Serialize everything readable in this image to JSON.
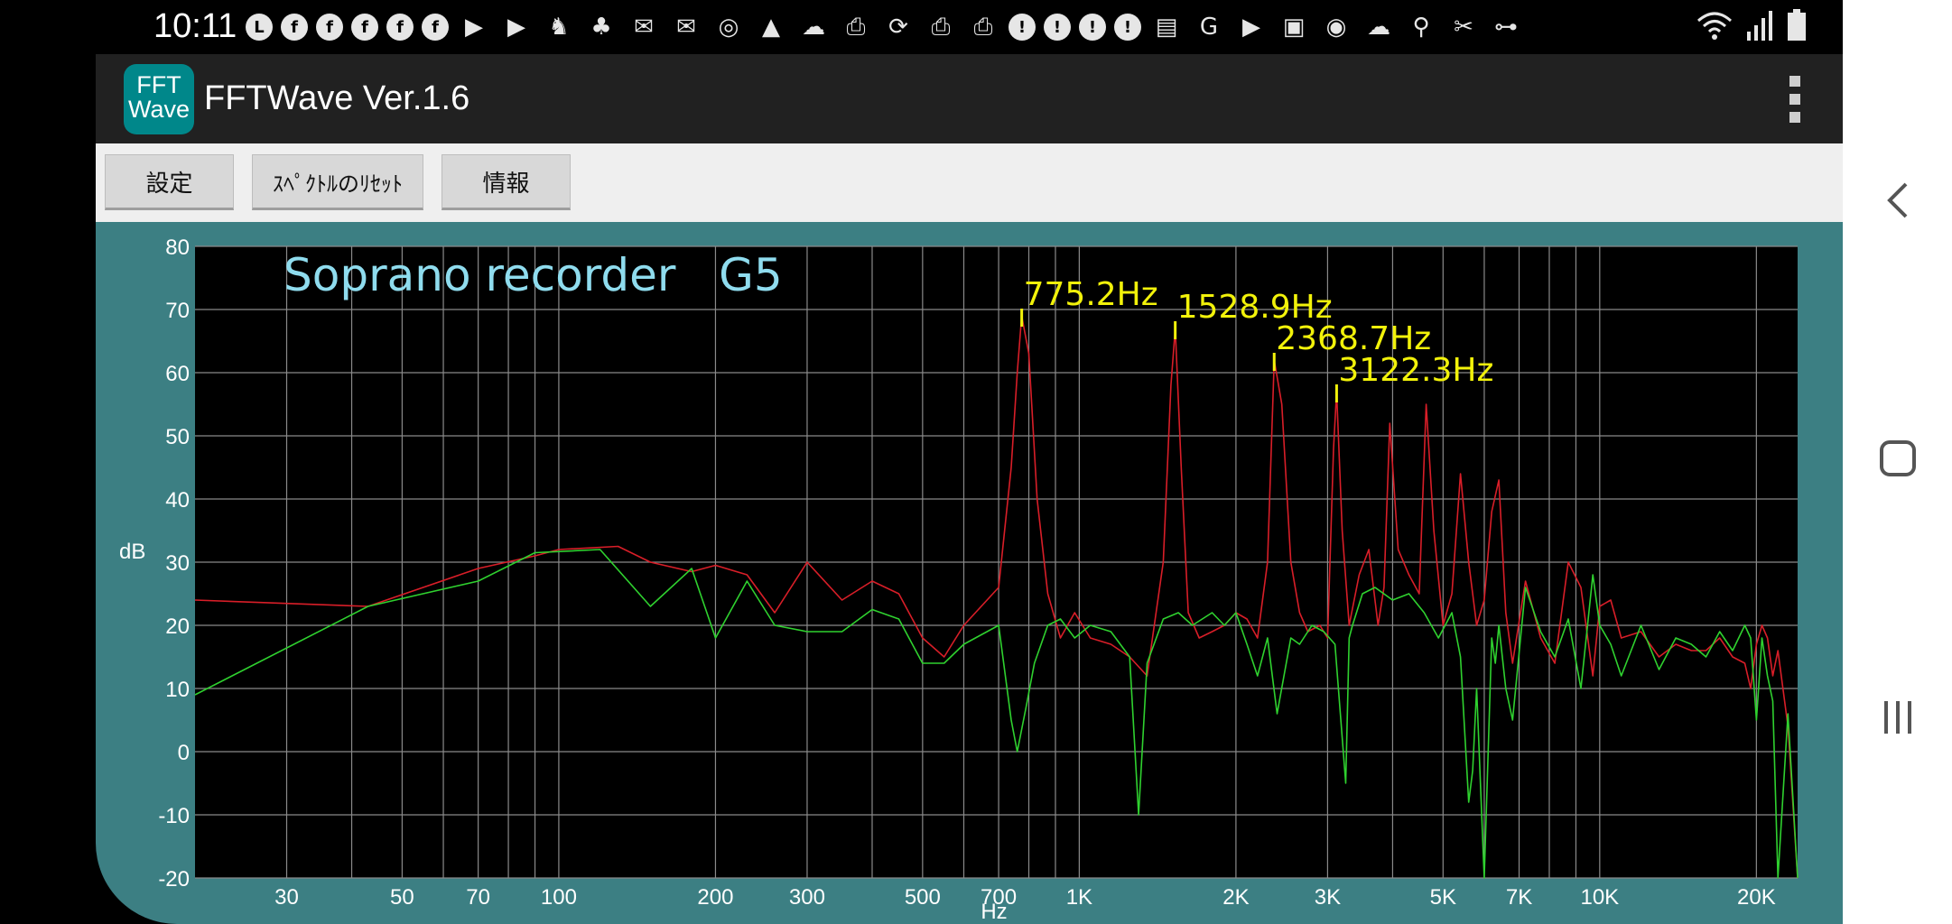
{
  "status_bar": {
    "time": "10:11",
    "notification_icons": [
      "line-icon",
      "facebook-icon",
      "facebook-icon",
      "facebook-icon",
      "facebook-icon",
      "facebook-icon",
      "youtube-icon",
      "youtube-icon",
      "evernote-icon",
      "pet-icon",
      "mail-icon",
      "gmail-icon",
      "instagram-icon",
      "drive-icon",
      "cloud-icon",
      "print-icon",
      "sync-icon",
      "print-icon",
      "print-icon",
      "alert-icon",
      "alert-icon",
      "alert-icon",
      "alert-icon",
      "router-icon",
      "translate-icon",
      "youtube-icon",
      "image-icon",
      "stadium-icon",
      "cloud-icon",
      "location-icon",
      "tools-icon",
      "vpn-key-icon"
    ],
    "system_icons": [
      "wifi-icon",
      "signal-icon",
      "battery-icon"
    ]
  },
  "app_bar": {
    "logo_top": "FFT",
    "logo_bottom": "Wave",
    "title": "FFTWave Ver.1.6",
    "menu_icon": "overflow-menu-icon"
  },
  "toolbar": {
    "settings_label": "設定",
    "reset_label": "ｽﾍﾟｸﾄﾙのﾘｾｯﾄ",
    "info_label": "情報"
  },
  "navigation_bar": {
    "back_icon": "back-icon",
    "home_icon": "home-icon",
    "recents_icon": "recents-icon"
  },
  "colors": {
    "panel_bg": "#3c7f83",
    "plot_bg": "#000000",
    "grid": "#8a8a8a",
    "series_red": "#d81e28",
    "series_green": "#2fd12f",
    "peak_label": "#f2f20a",
    "title_text": "#8fdcee"
  },
  "chart_data": {
    "type": "line",
    "title": "Soprano recorder   G5",
    "xlabel": "Hz",
    "ylabel": "dB",
    "x_scale": "log",
    "xlim": [
      20,
      24000
    ],
    "ylim": [
      -20,
      80
    ],
    "grid": true,
    "x_ticks": [
      {
        "value": 30,
        "label": "30"
      },
      {
        "value": 50,
        "label": "50"
      },
      {
        "value": 70,
        "label": "70"
      },
      {
        "value": 100,
        "label": "100"
      },
      {
        "value": 200,
        "label": "200"
      },
      {
        "value": 300,
        "label": "300"
      },
      {
        "value": 500,
        "label": "500"
      },
      {
        "value": 700,
        "label": "700"
      },
      {
        "value": 1000,
        "label": "1K"
      },
      {
        "value": 2000,
        "label": "2K"
      },
      {
        "value": 3000,
        "label": "3K"
      },
      {
        "value": 5000,
        "label": "5K"
      },
      {
        "value": 7000,
        "label": "7K"
      },
      {
        "value": 10000,
        "label": "10K"
      },
      {
        "value": 20000,
        "label": "20K"
      }
    ],
    "x_minor_gridlines": [
      40,
      60,
      80,
      90,
      400,
      600,
      800,
      900,
      4000,
      6000,
      8000,
      9000
    ],
    "y_ticks": [
      80,
      70,
      60,
      50,
      40,
      30,
      20,
      10,
      0,
      -10,
      -20
    ],
    "peak_labels": [
      {
        "label": "775.2Hz",
        "x": 775.2,
        "y": 69
      },
      {
        "label": "1528.9Hz",
        "x": 1528.9,
        "y": 67
      },
      {
        "label": "2368.7Hz",
        "x": 2368.7,
        "y": 62
      },
      {
        "label": "3122.3Hz",
        "x": 3122.3,
        "y": 57
      }
    ],
    "series": [
      {
        "color": "red",
        "x": [
          20,
          43,
          70,
          90,
          100,
          130,
          150,
          180,
          200,
          230,
          260,
          300,
          350,
          400,
          450,
          500,
          550,
          600,
          700,
          740,
          760,
          775,
          800,
          830,
          870,
          920,
          980,
          1050,
          1150,
          1250,
          1350,
          1450,
          1500,
          1529,
          1570,
          1620,
          1700,
          1800,
          1900,
          2000,
          2100,
          2200,
          2300,
          2369,
          2450,
          2550,
          2650,
          2750,
          2900,
          3000,
          3080,
          3122,
          3200,
          3300,
          3450,
          3600,
          3750,
          3850,
          3950,
          4100,
          4300,
          4500,
          4640,
          4800,
          5000,
          5200,
          5400,
          5600,
          5800,
          6000,
          6200,
          6400,
          6600,
          6800,
          7200,
          7700,
          8200,
          8700,
          9200,
          9700,
          10000,
          10500,
          11000,
          12000,
          13000,
          14000,
          15000,
          16000,
          17000,
          18000,
          19000,
          19500,
          20000,
          20500,
          21000,
          21500,
          22000,
          23000,
          24000
        ],
        "y": [
          24,
          23,
          29,
          31,
          32,
          32.5,
          30,
          28.5,
          29.5,
          28,
          22,
          30,
          24,
          27,
          25,
          18,
          15,
          20,
          26,
          45,
          60,
          69,
          63,
          40,
          25,
          18,
          22,
          18,
          17,
          15,
          12,
          30,
          58,
          67,
          45,
          22,
          18,
          19,
          20,
          22,
          21,
          18,
          30,
          62,
          55,
          30,
          22,
          19,
          20,
          18,
          48,
          57,
          35,
          20,
          28,
          32,
          20,
          26,
          52,
          32,
          28,
          25,
          55,
          35,
          20,
          25,
          44,
          30,
          20,
          24,
          38,
          43,
          22,
          14,
          27,
          18,
          14,
          30,
          26,
          12,
          23,
          24,
          18,
          19,
          15,
          17,
          16,
          16,
          18,
          15,
          14,
          10,
          17,
          20,
          18,
          12,
          16,
          4,
          -20
        ]
      },
      {
        "color": "green",
        "x": [
          20,
          43,
          70,
          90,
          120,
          150,
          180,
          200,
          230,
          260,
          300,
          350,
          400,
          450,
          500,
          550,
          600,
          700,
          740,
          760,
          790,
          820,
          870,
          920,
          980,
          1050,
          1150,
          1250,
          1300,
          1350,
          1450,
          1550,
          1650,
          1800,
          1900,
          2000,
          2100,
          2200,
          2300,
          2400,
          2550,
          2650,
          2800,
          2950,
          3100,
          3250,
          3300,
          3350,
          3500,
          3700,
          4000,
          4300,
          4600,
          4900,
          5200,
          5400,
          5600,
          5700,
          5800,
          6000,
          6200,
          6300,
          6400,
          6600,
          6800,
          7200,
          7700,
          8200,
          8700,
          9200,
          9700,
          10000,
          10500,
          11000,
          12000,
          13000,
          14000,
          15000,
          16000,
          17000,
          18000,
          19000,
          19500,
          20000,
          20500,
          21000,
          21500,
          22000,
          23000,
          24000
        ],
        "y": [
          9,
          23,
          27,
          31.5,
          32,
          23,
          29,
          18,
          27,
          20,
          19,
          19,
          22.5,
          21,
          14,
          14,
          17,
          20,
          5,
          0,
          7,
          14,
          20,
          21,
          18,
          20,
          19,
          15,
          -10,
          14,
          21,
          22,
          20,
          22,
          20,
          22,
          17,
          12,
          18,
          6,
          18,
          17,
          20,
          19,
          17,
          -5,
          18,
          20,
          25,
          26,
          24,
          25,
          22,
          18,
          22,
          15,
          -8,
          -3,
          10,
          -20,
          18,
          14,
          20,
          10,
          5,
          26,
          19,
          15,
          21,
          10,
          28,
          20,
          17,
          12,
          20,
          13,
          18,
          17,
          15,
          19,
          16,
          20,
          18,
          5,
          18,
          12,
          8,
          -20,
          6,
          -20
        ]
      }
    ]
  }
}
